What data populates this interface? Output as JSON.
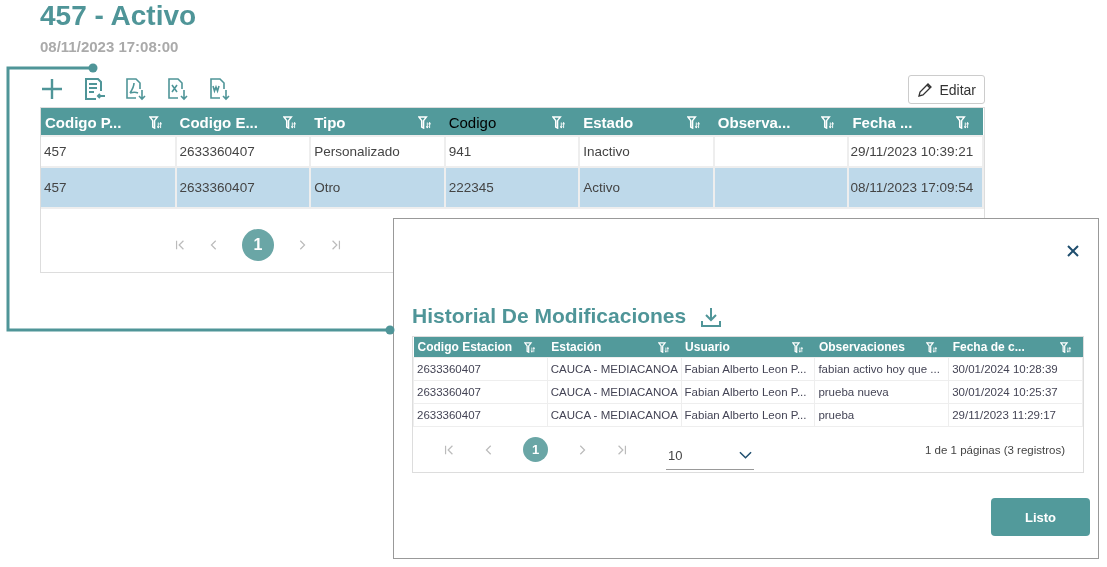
{
  "page": {
    "title": "457 - Activo",
    "date": "08/11/2023 17:08:00"
  },
  "toolbar": {
    "edit_button": "Editar"
  },
  "table": {
    "columns": [
      {
        "label": "Codigo P...",
        "hovered": false
      },
      {
        "label": "Codigo E...",
        "hovered": false
      },
      {
        "label": "Tipo",
        "hovered": false
      },
      {
        "label": "Codigo",
        "hovered": true
      },
      {
        "label": "Estado",
        "hovered": false
      },
      {
        "label": "Observa...",
        "hovered": false
      },
      {
        "label": "Fecha ...",
        "hovered": false
      }
    ],
    "rows": [
      {
        "selected": false,
        "cells": [
          "457",
          "2633360407",
          "Personalizado",
          "941",
          "Inactivo",
          "",
          "29/11/2023 10:39:21"
        ]
      },
      {
        "selected": true,
        "cells": [
          "457",
          "2633360407",
          "Otro",
          "222345",
          "Activo",
          "",
          "08/11/2023 17:09:54"
        ]
      }
    ]
  },
  "pager": {
    "pages": [
      {
        "label": "1",
        "selected": true
      }
    ]
  },
  "modal": {
    "title": "Historial De Modificaciones",
    "table": {
      "columns": [
        "Codigo Estacion",
        "Estación",
        "Usuario",
        "Observaciones",
        "Fecha de c..."
      ],
      "rows": [
        [
          "2633360407",
          "CAUCA - MEDIACANOA",
          "Fabian Alberto Leon P...",
          "fabian activo hoy que ...",
          "30/01/2024 10:28:39"
        ],
        [
          "2633360407",
          "CAUCA - MEDIACANOA",
          "Fabian Alberto Leon P...",
          "prueba nueva",
          "30/01/2024 10:25:37"
        ],
        [
          "2633360407",
          "CAUCA - MEDIACANOA",
          "Fabian Alberto Leon P...",
          "prueba",
          "29/11/2023 11:29:17"
        ]
      ]
    },
    "pager": {
      "pages": [
        {
          "label": "1",
          "selected": true
        }
      ],
      "page_size": "10",
      "summary": "1 de 1 páginas (3 registros)"
    },
    "done_button": "Listo"
  }
}
